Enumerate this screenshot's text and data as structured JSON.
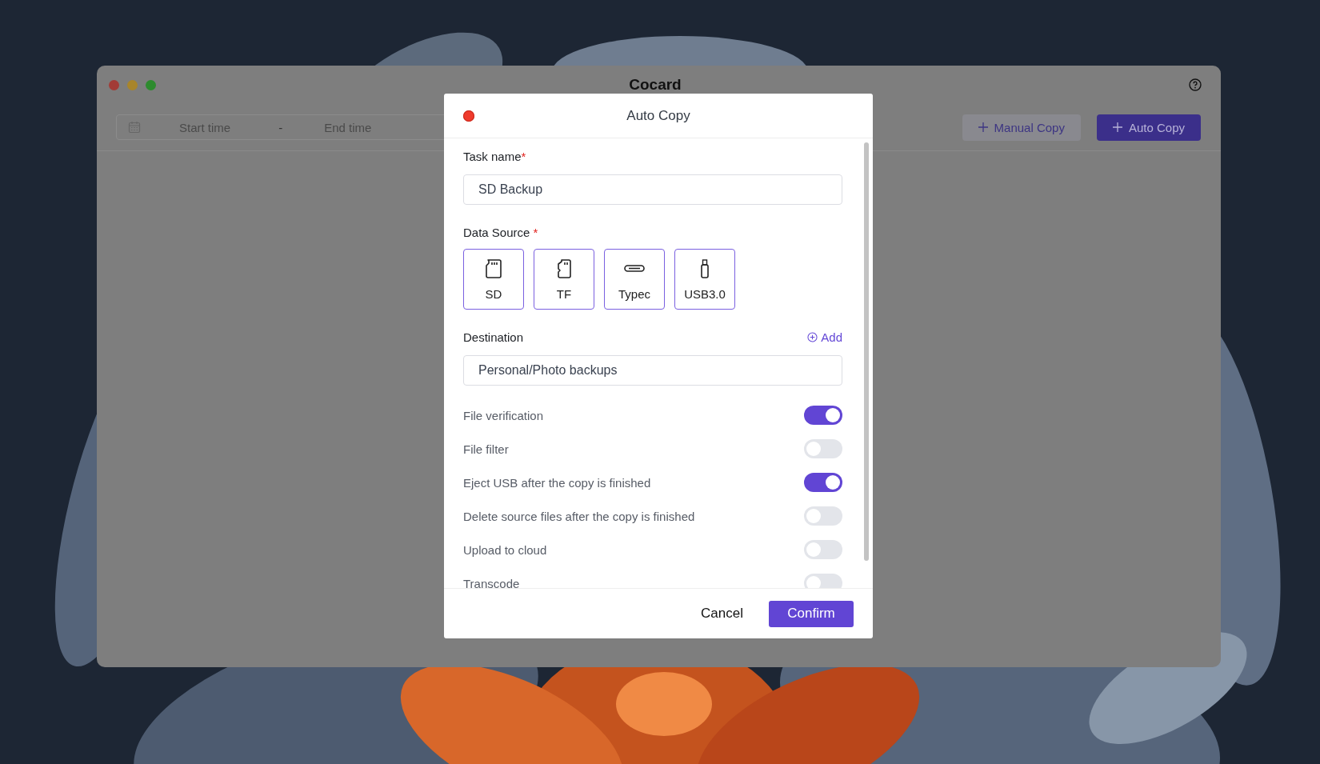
{
  "window": {
    "title": "Cocard"
  },
  "toolbar": {
    "date_range": {
      "start_placeholder": "Start time",
      "separator": "-",
      "end_placeholder": "End time"
    },
    "buttons": [
      {
        "label": "Manual Copy",
        "kind": "secondary"
      },
      {
        "label": "Auto Copy",
        "kind": "primary"
      }
    ]
  },
  "dialog": {
    "title": "Auto Copy",
    "task_name": {
      "label": "Task name",
      "required_mark": "*",
      "value": "SD Backup"
    },
    "data_source": {
      "label": "Data Source",
      "required_mark": "*",
      "options": [
        {
          "label": "SD",
          "kind": "sd"
        },
        {
          "label": "TF",
          "kind": "tf"
        },
        {
          "label": "Typec",
          "kind": "typec"
        },
        {
          "label": "USB3.0",
          "kind": "usb"
        }
      ]
    },
    "destination": {
      "label": "Destination",
      "add_label": "Add",
      "value": "Personal/Photo backups"
    },
    "options": [
      {
        "label": "File verification",
        "on": true
      },
      {
        "label": "File filter",
        "on": false
      },
      {
        "label": "Eject USB after the copy is finished",
        "on": true
      },
      {
        "label": "Delete source files after the copy is finished",
        "on": false
      },
      {
        "label": "Upload to cloud",
        "on": false
      },
      {
        "label": "Transcode",
        "on": false
      }
    ],
    "buttons": {
      "cancel": "Cancel",
      "confirm": "Confirm"
    }
  }
}
